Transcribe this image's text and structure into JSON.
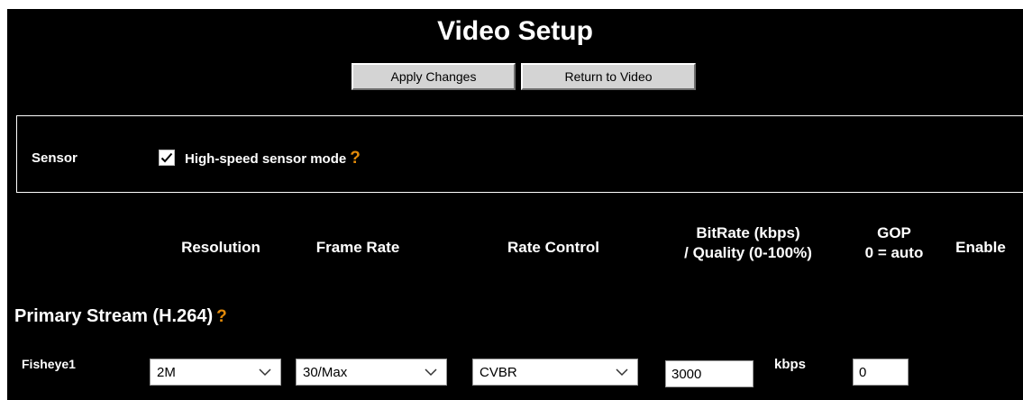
{
  "page": {
    "title": "Video Setup"
  },
  "toolbar": {
    "apply_label": "Apply Changes",
    "return_label": "Return to Video"
  },
  "sensor": {
    "label": "Sensor",
    "option_label": "High-speed sensor mode",
    "checked": true,
    "help": "?"
  },
  "columns": {
    "resolution": "Resolution",
    "frame_rate": "Frame Rate",
    "rate_control": "Rate Control",
    "bitrate_line1": "BitRate (kbps)",
    "bitrate_line2": "/ Quality (0-100%)",
    "gop_line1": "GOP",
    "gop_line2": "0 = auto",
    "enable": "Enable"
  },
  "primary_stream": {
    "title": "Primary Stream (H.264)",
    "help": "?",
    "rows": [
      {
        "label": "Fisheye1",
        "resolution": "2M",
        "frame_rate": "30/Max",
        "rate_control": "CVBR",
        "bitrate": "3000",
        "bitrate_unit": "kbps",
        "gop": "0"
      }
    ]
  },
  "colors": {
    "background": "#000000",
    "accent_help": "#e28a0a",
    "button_face": "#d4d4d4"
  },
  "icons": {
    "checkbox": "checkmark-icon",
    "dropdown": "chevron-down-icon"
  }
}
